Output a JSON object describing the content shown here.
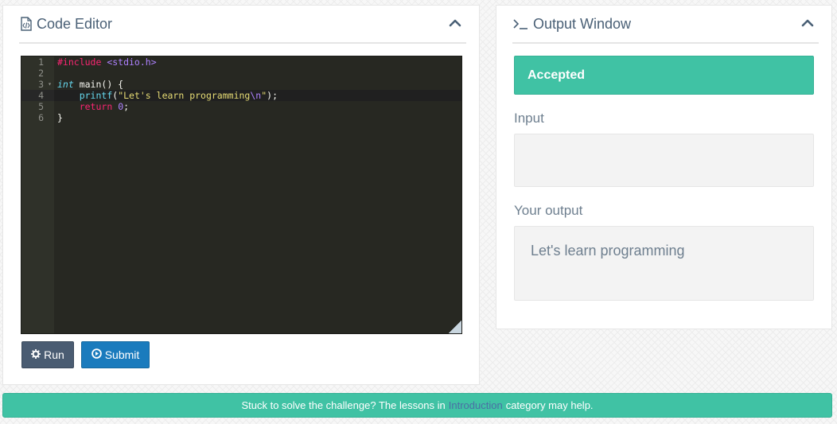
{
  "editor": {
    "title": "Code Editor",
    "icon": "code-file-icon",
    "collapse_icon": "chevron-up-icon",
    "line_numbers": [
      "1",
      "2",
      "3",
      "4",
      "5",
      "6"
    ],
    "code": {
      "l1_pre": "#include",
      "l1_inc": " <stdio.h>",
      "l3_type": "int",
      "l3_rest": " main() {",
      "l4_indent": "    ",
      "l4_fn": "printf",
      "l4_open": "(",
      "l4_str_a": "\"Let's learn programming",
      "l4_esc": "\\n",
      "l4_str_b": "\"",
      "l4_close": ");",
      "l5_indent": "    ",
      "l5_kw": "return",
      "l5_sp": " ",
      "l5_num": "0",
      "l5_semi": ";",
      "l6": "}"
    },
    "run_label": "Run",
    "submit_label": "Submit",
    "run_icon": "gear-icon",
    "submit_icon": "play-circle-icon"
  },
  "output": {
    "title": "Output Window",
    "icon": "terminal-prompt-icon",
    "collapse_icon": "chevron-up-icon",
    "status": "Accepted",
    "input_label": "Input",
    "input_value": "",
    "output_label": "Your output",
    "output_value": "Let's learn programming"
  },
  "hint": {
    "before": "Stuck to solve the challenge? The lessons in",
    "link": "Introduction",
    "after": "category may help."
  },
  "colors": {
    "accent_green": "#40c2a4",
    "run_button": "#4a5c72",
    "submit_button": "#1a7bbd",
    "editor_bg": "#272822"
  }
}
